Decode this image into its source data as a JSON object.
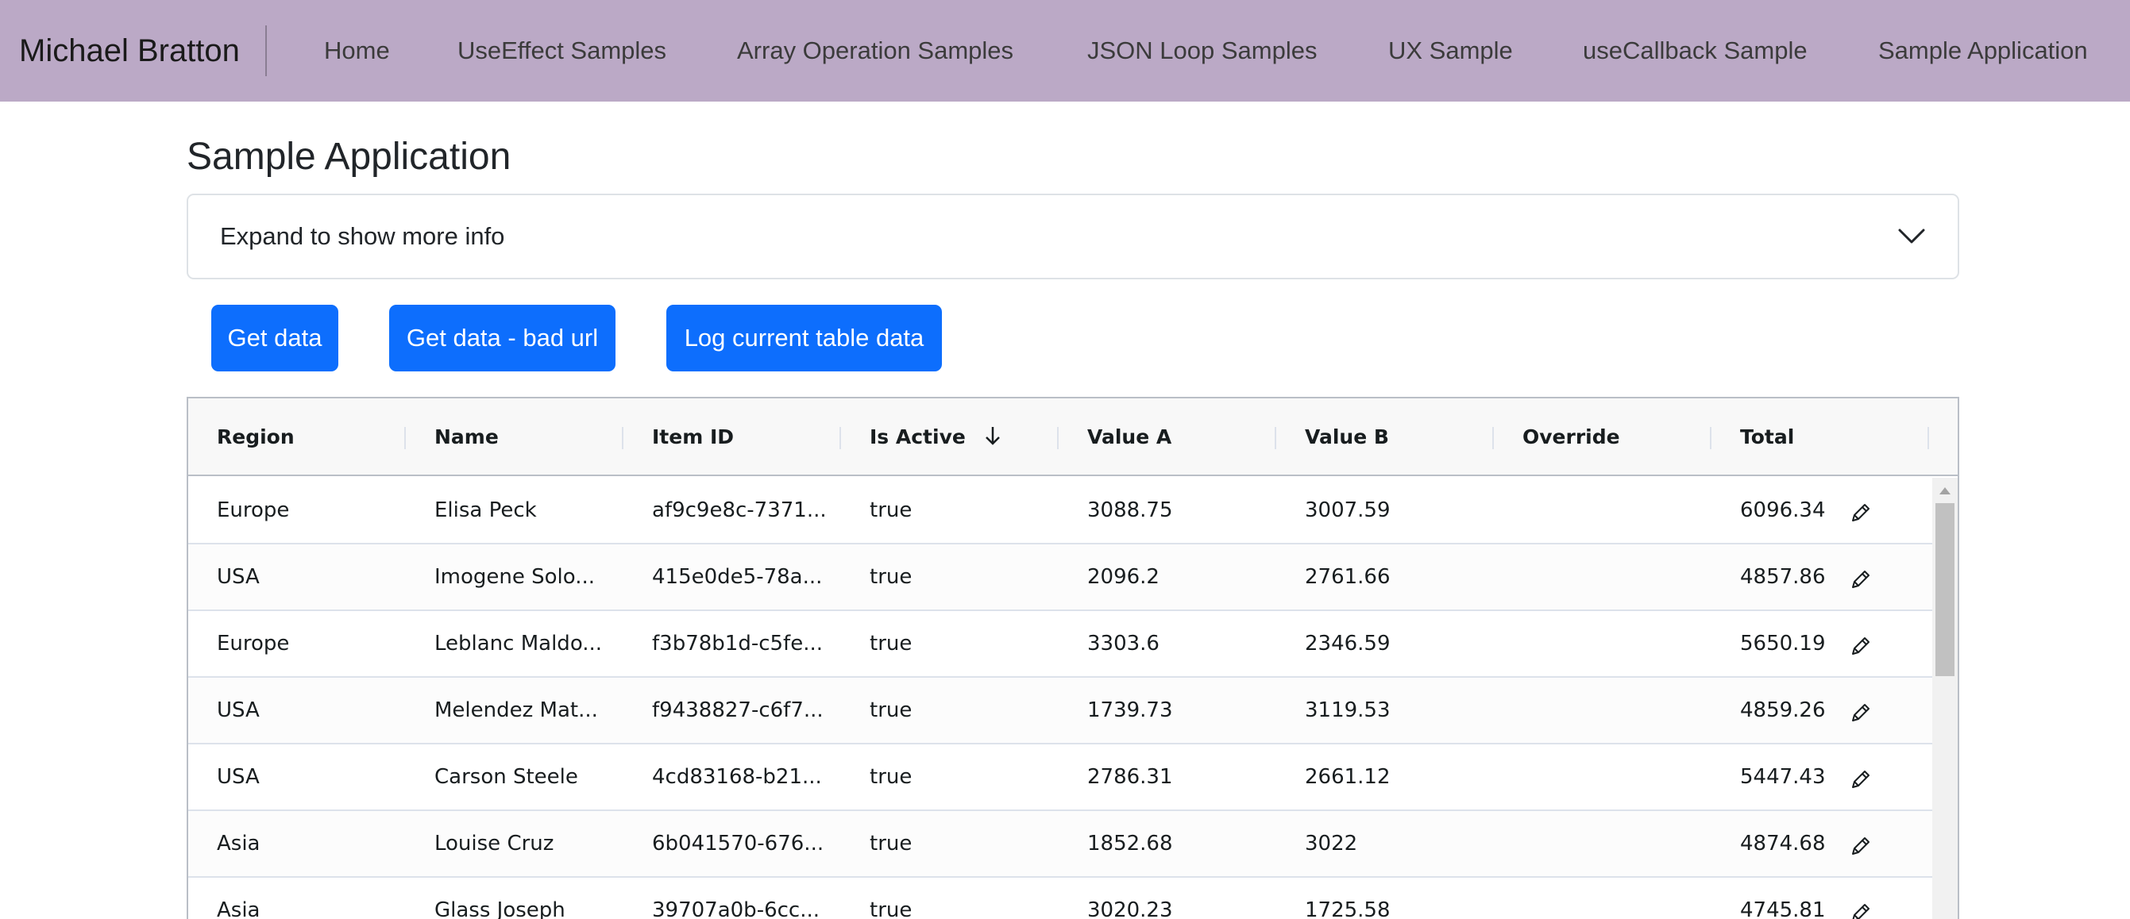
{
  "navbar": {
    "brand": "Michael Bratton",
    "links": [
      "Home",
      "UseEffect Samples",
      "Array Operation Samples",
      "JSON Loop Samples",
      "UX Sample",
      "useCallback Sample",
      "Sample Application"
    ]
  },
  "page": {
    "title": "Sample Application",
    "accordion_label": "Expand to show more info",
    "accordion_icon": "chevron-down-icon"
  },
  "buttons": {
    "get_data": "Get data",
    "get_data_bad_url": "Get data - bad url",
    "log_table": "Log current table data"
  },
  "grid": {
    "columns": [
      "Region",
      "Name",
      "Item ID",
      "Is Active",
      "Value A",
      "Value B",
      "Override",
      "Total"
    ],
    "sorted_column": "Is Active",
    "sort_direction": "descending",
    "rows": [
      {
        "region": "Europe",
        "name": "Elisa Peck",
        "item_id": "af9c9e8c-7371...",
        "is_active": "true",
        "value_a": "3088.75",
        "value_b": "3007.59",
        "total": "6096.34"
      },
      {
        "region": "USA",
        "name": "Imogene Solo...",
        "item_id": "415e0de5-78a...",
        "is_active": "true",
        "value_a": "2096.2",
        "value_b": "2761.66",
        "total": "4857.86"
      },
      {
        "region": "Europe",
        "name": "Leblanc Maldo...",
        "item_id": "f3b78b1d-c5fe...",
        "is_active": "true",
        "value_a": "3303.6",
        "value_b": "2346.59",
        "total": "5650.19"
      },
      {
        "region": "USA",
        "name": "Melendez Mat...",
        "item_id": "f9438827-c6f7...",
        "is_active": "true",
        "value_a": "1739.73",
        "value_b": "3119.53",
        "total": "4859.26"
      },
      {
        "region": "USA",
        "name": "Carson Steele",
        "item_id": "4cd83168-b21...",
        "is_active": "true",
        "value_a": "2786.31",
        "value_b": "2661.12",
        "total": "5447.43"
      },
      {
        "region": "Asia",
        "name": "Louise Cruz",
        "item_id": "6b041570-676...",
        "is_active": "true",
        "value_a": "1852.68",
        "value_b": "3022",
        "total": "4874.68"
      },
      {
        "region": "Asia",
        "name": "Glass Joseph",
        "item_id": "39707a0b-6cc...",
        "is_active": "true",
        "value_a": "3020.23",
        "value_b": "1725.58",
        "total": "4745.81"
      }
    ],
    "override_icon": "pencil-icon"
  },
  "colors": {
    "navbar_bg": "#bba9c6",
    "primary_button": "#0d6efd",
    "grid_header_bg": "#f8f8f8"
  }
}
